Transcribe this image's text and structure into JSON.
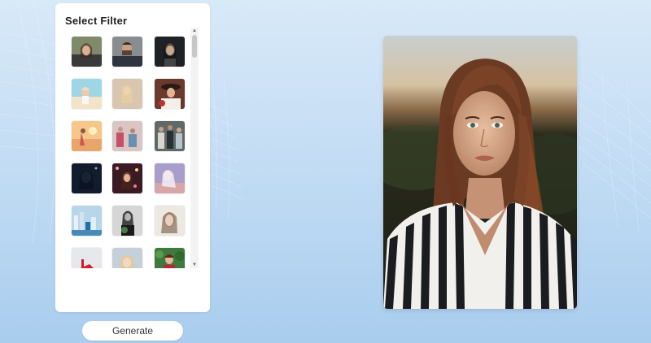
{
  "filter_panel": {
    "title": "Select Filter",
    "thumbnails": [
      "portrait-woman-dark-hair",
      "portrait-man-beard",
      "portrait-woman-dark-frame",
      "woman-beach-pastel",
      "woman-long-hair-light",
      "woman-hat-vintage",
      "woman-sunset-dress",
      "women-group-street",
      "group-portrait-indoor",
      "night-portrait-blue",
      "woman-neon-lights",
      "woman-dreamy-purple",
      "city-scene-blue",
      "woman-plant-bw",
      "woman-sketch-style",
      "red-shoes-still",
      "woman-blonde-soft",
      "woman-red-dress-green"
    ]
  },
  "actions": {
    "generate_label": "Generate"
  },
  "preview": {
    "image": "portrait-woman-striped-shirt-sunset"
  }
}
